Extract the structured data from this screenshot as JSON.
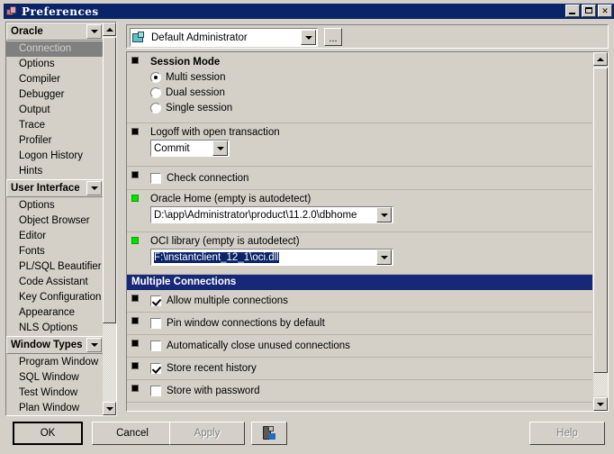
{
  "window": {
    "title": "Preferences",
    "icon": "preferences-icon",
    "minimize_label": "_",
    "maximize_label": "□",
    "close_label": "✕"
  },
  "sidebar": {
    "groups": [
      {
        "name": "Oracle",
        "expanded": true,
        "items": [
          {
            "label": "Connection",
            "selected": true
          },
          {
            "label": "Options",
            "selected": false
          },
          {
            "label": "Compiler",
            "selected": false
          },
          {
            "label": "Debugger",
            "selected": false
          },
          {
            "label": "Output",
            "selected": false
          },
          {
            "label": "Trace",
            "selected": false
          },
          {
            "label": "Profiler",
            "selected": false
          },
          {
            "label": "Logon History",
            "selected": false
          },
          {
            "label": "Hints",
            "selected": false
          }
        ]
      },
      {
        "name": "User Interface",
        "expanded": true,
        "items": [
          {
            "label": "Options",
            "selected": false
          },
          {
            "label": "Object Browser",
            "selected": false
          },
          {
            "label": "Editor",
            "selected": false
          },
          {
            "label": "Fonts",
            "selected": false
          },
          {
            "label": "PL/SQL Beautifier",
            "selected": false
          },
          {
            "label": "Code Assistant",
            "selected": false
          },
          {
            "label": "Key Configuration",
            "selected": false
          },
          {
            "label": "Appearance",
            "selected": false
          },
          {
            "label": "NLS Options",
            "selected": false
          }
        ]
      },
      {
        "name": "Window Types",
        "expanded": true,
        "items": [
          {
            "label": "Program Window",
            "selected": false
          },
          {
            "label": "SQL Window",
            "selected": false
          },
          {
            "label": "Test Window",
            "selected": false
          },
          {
            "label": "Plan Window",
            "selected": false
          }
        ]
      }
    ]
  },
  "profile": {
    "value": "Default Administrator",
    "icon": "profile-icon",
    "more_label": "...",
    "dropdown_icon": "chevron-down-icon"
  },
  "options": {
    "session_mode": {
      "title": "Session Mode",
      "marker": "black",
      "choices": [
        {
          "label": "Multi session",
          "selected": true
        },
        {
          "label": "Dual session",
          "selected": false
        },
        {
          "label": "Single session",
          "selected": false
        }
      ]
    },
    "logoff": {
      "label": "Logoff with open transaction",
      "marker": "black",
      "value": "Commit"
    },
    "check_connection": {
      "label": "Check connection",
      "marker": "black",
      "checked": false
    },
    "oracle_home": {
      "label": "Oracle Home (empty is autodetect)",
      "marker": "green",
      "value": "D:\\app\\Administrator\\product\\11.2.0\\dbhome"
    },
    "oci_library": {
      "label": "OCI library (empty is autodetect)",
      "marker": "green",
      "value": "F:\\instantclient_12_1\\oci.dll",
      "text_selected": true
    },
    "multiple_connections_band": "Multiple Connections",
    "allow_multiple": {
      "label": "Allow multiple connections",
      "marker": "black",
      "checked": true
    },
    "pin_window": {
      "label": "Pin window connections by default",
      "marker": "black",
      "checked": false
    },
    "auto_close": {
      "label": "Automatically close unused connections",
      "marker": "black",
      "checked": false
    },
    "store_recent": {
      "label": "Store recent history",
      "marker": "black",
      "checked": true
    },
    "store_password": {
      "label": "Store with password",
      "marker": "black",
      "checked": false
    }
  },
  "buttons": {
    "ok": "OK",
    "cancel": "Cancel",
    "apply": "Apply",
    "apply_disabled": true,
    "copy_icon": "copy-preferences-icon",
    "help": "Help"
  },
  "colors": {
    "titlebar": "#0a246a",
    "face": "#d4d0c8",
    "band": "#182878",
    "selection": "#0a246a",
    "marker_green": "#00e000",
    "selected_item": "#808080"
  }
}
